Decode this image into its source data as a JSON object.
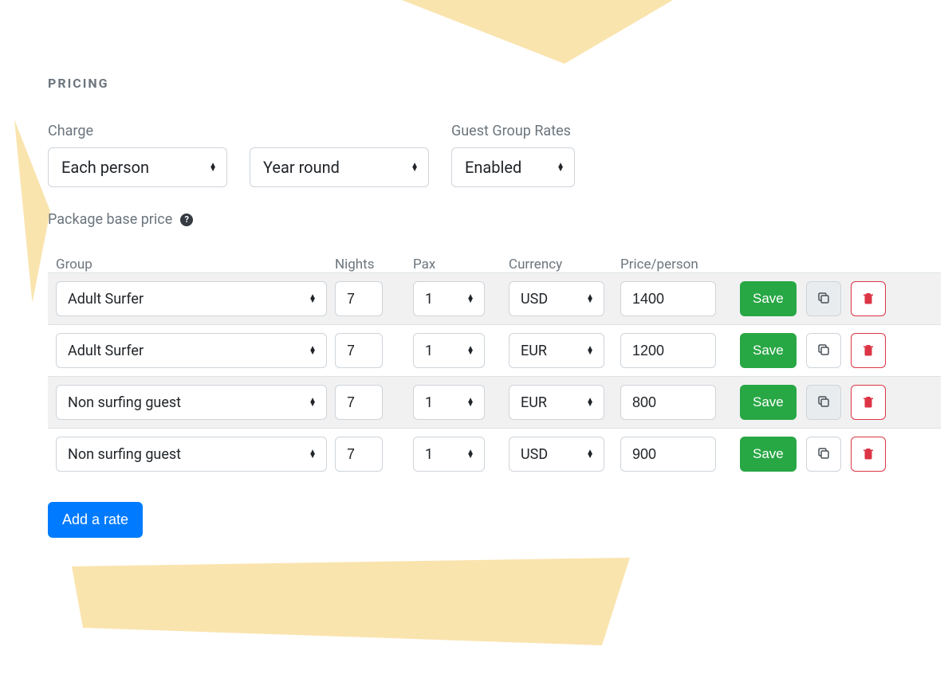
{
  "section_title": "PRICING",
  "top": {
    "charge_label": "Charge",
    "charge_value": "Each person",
    "period_value": "Year round",
    "group_rates_label": "Guest Group Rates",
    "group_rates_value": "Enabled"
  },
  "base_price_label": "Package base price",
  "columns": {
    "group": "Group",
    "nights": "Nights",
    "pax": "Pax",
    "currency": "Currency",
    "price": "Price/person"
  },
  "save_label": "Save",
  "add_rate_label": "Add a rate",
  "rows": [
    {
      "group": "Adult Surfer",
      "nights": "7",
      "pax": "1",
      "currency": "USD",
      "price": "1400",
      "shaded": true
    },
    {
      "group": "Adult Surfer",
      "nights": "7",
      "pax": "1",
      "currency": "EUR",
      "price": "1200",
      "shaded": false
    },
    {
      "group": "Non surfing guest",
      "nights": "7",
      "pax": "1",
      "currency": "EUR",
      "price": "800",
      "shaded": true
    },
    {
      "group": "Non surfing guest",
      "nights": "7",
      "pax": "1",
      "currency": "USD",
      "price": "900",
      "shaded": false
    }
  ]
}
